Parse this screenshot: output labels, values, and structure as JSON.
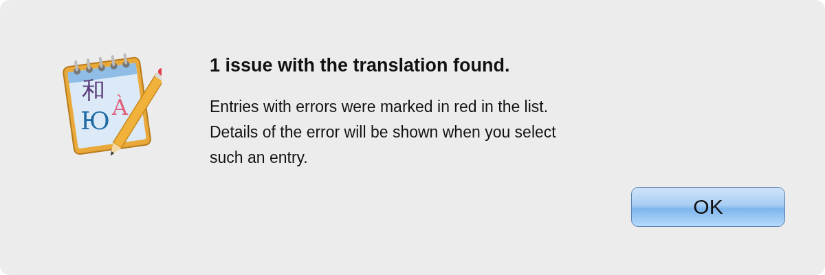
{
  "dialog": {
    "icon_glyphs": [
      {
        "text": "和",
        "color": "#5a3d7a"
      },
      {
        "text": "Ю",
        "color": "#1f6aa5"
      },
      {
        "text": "À",
        "color": "#e0607a"
      }
    ],
    "title": "1 issue with the translation found.",
    "message": [
      "Entries with errors were marked in red in the list.",
      "Details of the error will be shown when you select",
      "such an entry."
    ],
    "buttons": [
      {
        "label": "OK",
        "default": true
      }
    ]
  }
}
